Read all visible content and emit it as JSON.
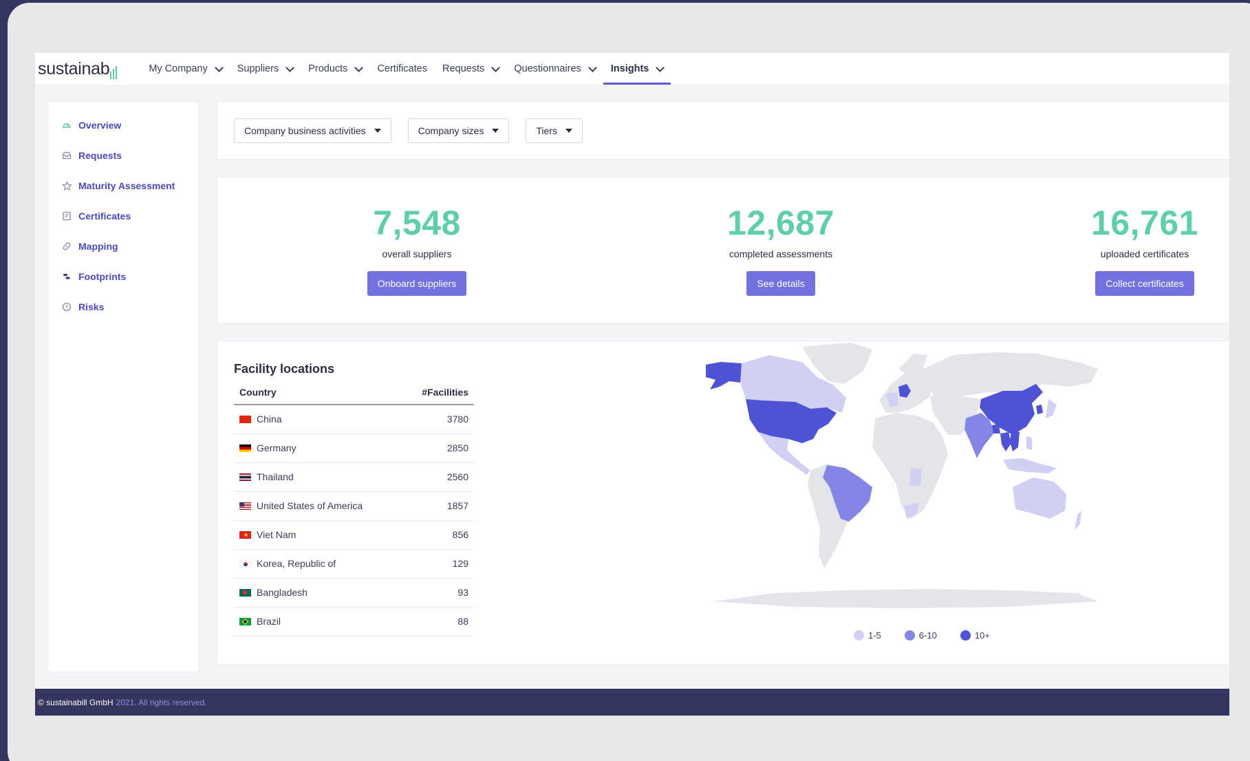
{
  "brand": {
    "name": "sustainab"
  },
  "nav": {
    "items": [
      {
        "label": "My Company",
        "dropdown": true
      },
      {
        "label": "Suppliers",
        "dropdown": true
      },
      {
        "label": "Products",
        "dropdown": true
      },
      {
        "label": "Certificates",
        "dropdown": false
      },
      {
        "label": "Requests",
        "dropdown": true
      },
      {
        "label": "Questionnaires",
        "dropdown": true
      },
      {
        "label": "Insights",
        "dropdown": true,
        "active": true
      }
    ]
  },
  "sidebar": {
    "items": [
      {
        "label": "Overview",
        "icon": "gauge-icon"
      },
      {
        "label": "Requests",
        "icon": "inbox-icon"
      },
      {
        "label": "Maturity Assessment",
        "icon": "star-icon"
      },
      {
        "label": "Certificates",
        "icon": "certificate-icon"
      },
      {
        "label": "Mapping",
        "icon": "link-icon"
      },
      {
        "label": "Footprints",
        "icon": "footprints-icon"
      },
      {
        "label": "Risks",
        "icon": "alert-circle-icon"
      }
    ]
  },
  "filters": {
    "business_activities": "Company business activities",
    "company_sizes": "Company sizes",
    "tiers": "Tiers"
  },
  "stats": [
    {
      "value": "7,548",
      "label": "overall suppliers",
      "button": "Onboard suppliers"
    },
    {
      "value": "12,687",
      "label": "completed assessments",
      "button": "See details"
    },
    {
      "value": "16,761",
      "label": "uploaded certificates",
      "button": "Collect certificates"
    }
  ],
  "facility": {
    "title": "Facility locations",
    "col_country": "Country",
    "col_facilities": "#Facilities",
    "rows": [
      {
        "country": "China",
        "count": "3780"
      },
      {
        "country": "Germany",
        "count": "2850"
      },
      {
        "country": "Thailand",
        "count": "2560"
      },
      {
        "country": "United States of America",
        "count": "1857"
      },
      {
        "country": "Viet Nam",
        "count": "856"
      },
      {
        "country": "Korea, Republic of",
        "count": "129"
      },
      {
        "country": "Bangladesh",
        "count": "93"
      },
      {
        "country": "Brazil",
        "count": "88"
      }
    ],
    "legend": [
      {
        "label": "1-5",
        "color": "#cfd0f4"
      },
      {
        "label": "6-10",
        "color": "#8486e6"
      },
      {
        "label": "10+",
        "color": "#4f52d4"
      }
    ]
  },
  "colors": {
    "accent": "#5b5bd6",
    "stat_green": "#5ecfa8",
    "button": "#7171e0",
    "footer": "#34365f"
  },
  "footer": {
    "owner": "© sustainabill GmbH",
    "rest": "2021. All rights reserved."
  }
}
